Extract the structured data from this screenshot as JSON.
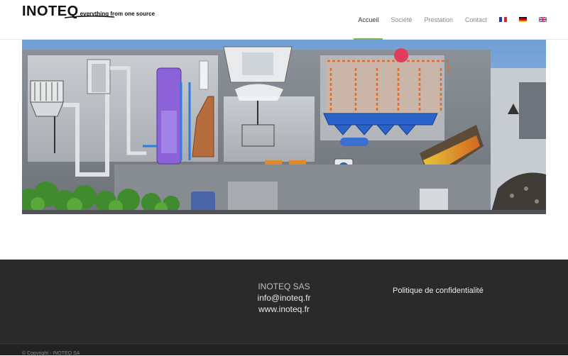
{
  "header": {
    "logo_text": "INOTEQ",
    "logo_tagline": "everything from one source",
    "brand_accent": "#7bb44a",
    "nav": [
      {
        "label": "Accueil",
        "active": true
      },
      {
        "label": "Société",
        "active": false
      },
      {
        "label": "Prestation",
        "active": false
      },
      {
        "label": "Contact",
        "active": false
      }
    ],
    "languages": [
      {
        "code": "fr",
        "icon": "flag-france-icon"
      },
      {
        "code": "de",
        "icon": "flag-germany-icon"
      },
      {
        "code": "en",
        "icon": "flag-uk-icon"
      }
    ]
  },
  "hero": {
    "image": "industrial-plant-cutaway-illustration"
  },
  "footer": {
    "company": "INOTEQ SAS",
    "email": "info@inoteq.fr",
    "website": "www.inoteq.fr",
    "privacy_label": "Politique de confidentialité",
    "copyright": "© Copyright - INOTEQ SA"
  }
}
